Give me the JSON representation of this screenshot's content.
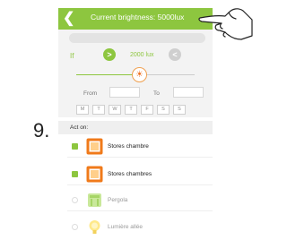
{
  "step_number": "9.",
  "header": {
    "back_icon": "chevron-left-icon",
    "title": "Current brightness: 5000lux"
  },
  "condition": {
    "if_label": "If",
    "operator_greater": ">",
    "lux_value": "2000 lux",
    "operator_less": "<",
    "slider_level_percent": 50
  },
  "time_range": {
    "from_label": "From",
    "to_label": "To",
    "from_value": "",
    "to_value": ""
  },
  "days": [
    "M",
    "T",
    "W",
    "T",
    "F",
    "S",
    "S"
  ],
  "act_on": {
    "label": "Act on:",
    "items": [
      {
        "label": "Stores chambre",
        "checked": true,
        "icon": "window-shutter-icon"
      },
      {
        "label": "Stores chambres",
        "checked": true,
        "icon": "window-shutter-icon"
      },
      {
        "label": "Pergola",
        "checked": false,
        "icon": "pergola-icon"
      },
      {
        "label": "Lumière allée",
        "checked": false,
        "icon": "light-bulb-icon"
      }
    ]
  },
  "colors": {
    "accent": "#8dc63f",
    "shutter_orange": "#f07a1a",
    "slider_thumb": "#f07020"
  }
}
